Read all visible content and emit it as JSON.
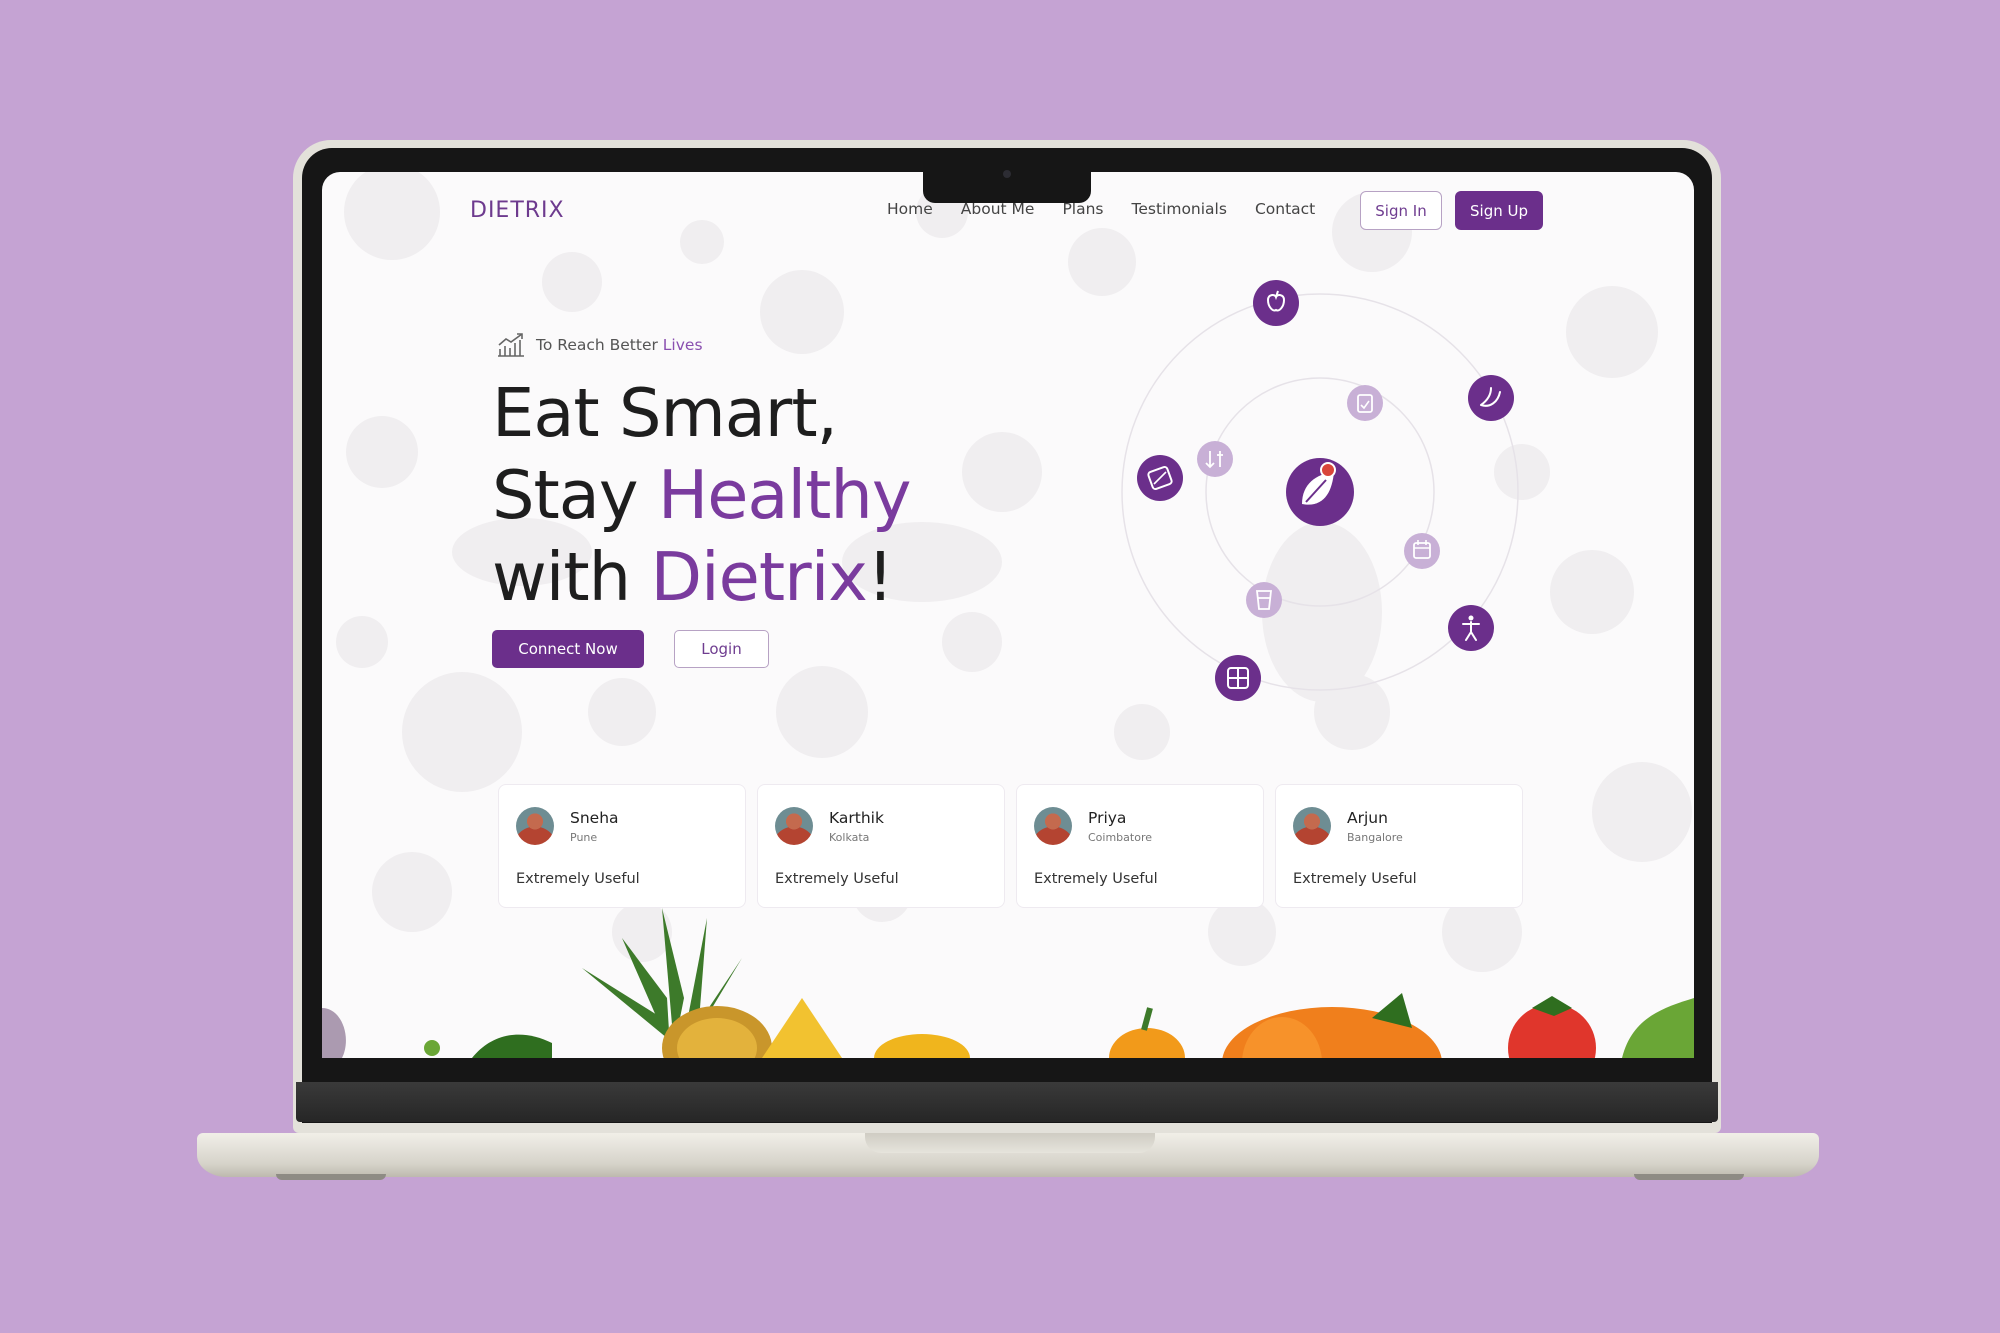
{
  "nav": {
    "logo": "DIETRIX",
    "links": [
      "Home",
      "About Me",
      "Plans",
      "Testimonials",
      "Contact"
    ],
    "sign_in": "Sign In",
    "sign_up": "Sign Up"
  },
  "hero": {
    "tagline_prefix": "To Reach Better ",
    "tagline_accent": "Lives",
    "line1": "Eat Smart,",
    "line2_prefix": "Stay ",
    "line2_accent": "Healthy",
    "line3_prefix": "with ",
    "line3_accent": "Dietrix",
    "line3_suffix": "!",
    "connect_button": "Connect Now",
    "login_button": "Login"
  },
  "testimonials": [
    {
      "name": "Sneha",
      "city": "Pune",
      "review": "Extremely Useful"
    },
    {
      "name": "Karthik",
      "city": "Kolkata",
      "review": "Extremely Useful"
    },
    {
      "name": "Priya",
      "city": "Coimbatore",
      "review": "Extremely Useful"
    },
    {
      "name": "Arjun",
      "city": "Bangalore",
      "review": "Extremely Useful"
    }
  ],
  "colors": {
    "brand": "#6b2f8b",
    "accent_text": "#7a3b9e",
    "light_purple": "#c8b0d6",
    "background": "#c5a3d3"
  },
  "orbit_icons": [
    "apple-icon",
    "banana-icon",
    "fitness-icon",
    "meal-plan-icon",
    "percent-tag-icon",
    "clipboard-icon",
    "sort-icon",
    "calendar-icon",
    "glass-icon",
    "leaf-logo-icon"
  ]
}
